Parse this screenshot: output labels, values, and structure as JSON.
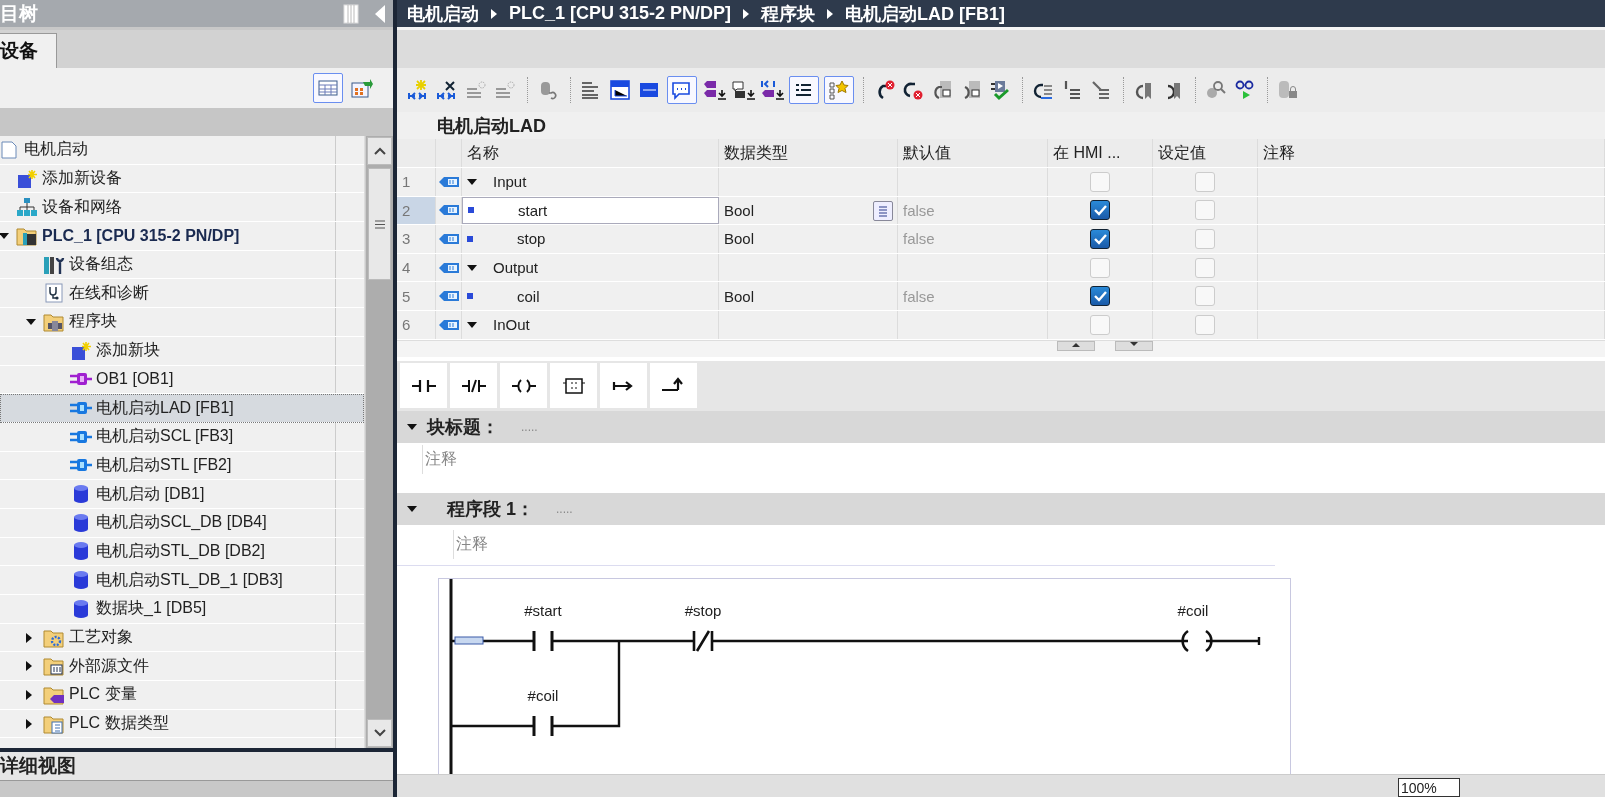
{
  "project_tree": {
    "title": "目树",
    "tabs": [
      {
        "label": "设备",
        "selected": true
      }
    ],
    "items": [
      {
        "label": "电机启动",
        "kind": "project",
        "selected": false,
        "active": false,
        "children": [
          {
            "label": "添加新设备",
            "kind": "add-device",
            "selected": false,
            "active": false
          },
          {
            "label": "设备和网络",
            "kind": "network",
            "selected": false,
            "active": false
          },
          {
            "label": "PLC_1 [CPU 315-2 PN/DP]",
            "kind": "plc",
            "expanded": true,
            "selected": false,
            "active": true,
            "children": [
              {
                "label": "设备组态",
                "kind": "config",
                "selected": false,
                "active": false
              },
              {
                "label": "在线和诊断",
                "kind": "diagnostics",
                "selected": false,
                "active": false
              },
              {
                "label": "程序块",
                "kind": "folder-blocks",
                "expanded": true,
                "selected": false,
                "active": false,
                "children": [
                  {
                    "label": "添加新块",
                    "kind": "add-device",
                    "selected": false,
                    "active": false
                  },
                  {
                    "label": "OB1 [OB1]",
                    "kind": "ob",
                    "selected": false,
                    "active": false
                  },
                  {
                    "label": "电机启动LAD [FB1]",
                    "kind": "fb",
                    "selected": true,
                    "active": false
                  },
                  {
                    "label": "电机启动SCL [FB3]",
                    "kind": "fb",
                    "selected": false,
                    "active": false
                  },
                  {
                    "label": "电机启动STL [FB2]",
                    "kind": "fb",
                    "selected": false,
                    "active": false
                  },
                  {
                    "label": "电机启动 [DB1]",
                    "kind": "db",
                    "selected": false,
                    "active": false
                  },
                  {
                    "label": "电机启动SCL_DB [DB4]",
                    "kind": "db",
                    "selected": false,
                    "active": false
                  },
                  {
                    "label": "电机启动STL_DB [DB2]",
                    "kind": "db",
                    "selected": false,
                    "active": false
                  },
                  {
                    "label": "电机启动STL_DB_1 [DB3]",
                    "kind": "db",
                    "selected": false,
                    "active": false
                  },
                  {
                    "label": "数据块_1 [DB5]",
                    "kind": "db",
                    "selected": false,
                    "active": false
                  }
                ]
              },
              {
                "label": "工艺对象",
                "kind": "folder-tech",
                "expanded": false,
                "selected": false,
                "active": false
              },
              {
                "label": "外部源文件",
                "kind": "folder-source",
                "expanded": false,
                "selected": false,
                "active": false
              },
              {
                "label": "PLC 变量",
                "kind": "folder-tags",
                "expanded": false,
                "selected": false,
                "active": false
              },
              {
                "label": "PLC 数据类型",
                "kind": "folder-types",
                "expanded": false,
                "selected": false,
                "active": false
              }
            ]
          }
        ]
      }
    ]
  },
  "details_view": {
    "title": "详细视图"
  },
  "editor": {
    "breadcrumb": [
      "电机启动",
      "PLC_1 [CPU 315-2 PN/DP]",
      "程序块",
      "电机启动LAD [FB1]"
    ],
    "block_name": "电机启动LAD",
    "interface": {
      "columns": [
        "名称",
        "数据类型",
        "默认值",
        "在 HMI ...",
        "设定值",
        "注释"
      ],
      "rows": [
        {
          "number": "1",
          "kind": "section",
          "name": "Input",
          "expanded": true,
          "hmi": false,
          "setpoint": false,
          "selected": false
        },
        {
          "number": "2",
          "kind": "variable",
          "name": "start",
          "data_type": "Bool",
          "default": "false",
          "hmi": true,
          "setpoint": false,
          "selected": true
        },
        {
          "number": "3",
          "kind": "variable",
          "name": "stop",
          "data_type": "Bool",
          "default": "false",
          "hmi": true,
          "setpoint": false,
          "selected": false
        },
        {
          "number": "4",
          "kind": "section",
          "name": "Output",
          "expanded": true,
          "hmi": false,
          "setpoint": false,
          "selected": false
        },
        {
          "number": "5",
          "kind": "variable",
          "name": "coil",
          "data_type": "Bool",
          "default": "false",
          "hmi": true,
          "setpoint": false,
          "selected": false
        },
        {
          "number": "6",
          "kind": "section",
          "name": "InOut",
          "expanded": true,
          "hmi": false,
          "setpoint": false,
          "selected": false
        }
      ]
    },
    "block_title": {
      "label": "块标题：",
      "title": ".....",
      "comment": "注释",
      "expanded": true
    },
    "networks": [
      {
        "label": "程序段 1：",
        "title": ".....",
        "comment": "注释",
        "expanded": true,
        "main_rung": [
          {
            "kind": "no_contact",
            "operand": "#start"
          },
          {
            "kind": "nc_contact",
            "operand": "#stop"
          },
          {
            "kind": "coil",
            "operand": "#coil"
          }
        ],
        "parallel_branch": [
          {
            "kind": "no_contact",
            "operand": "#coil"
          }
        ]
      }
    ]
  },
  "zoom": "100%"
}
